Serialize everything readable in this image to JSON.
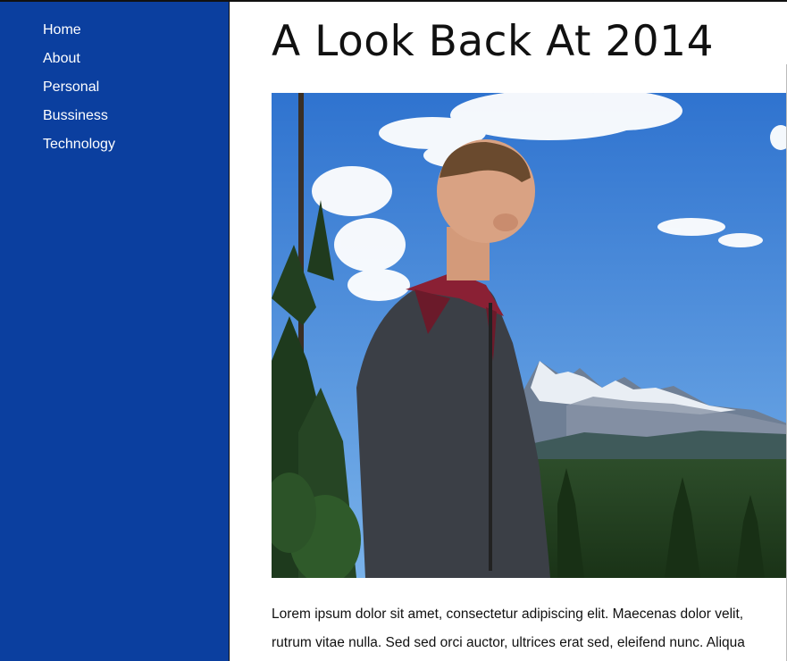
{
  "nav": {
    "items": [
      {
        "label": "Home"
      },
      {
        "label": "About"
      },
      {
        "label": "Personal"
      },
      {
        "label": "Bussiness"
      },
      {
        "label": "Technology"
      }
    ]
  },
  "article": {
    "title": "A Look Back At 2014",
    "image_alt": "Man in a grey hoodie looking over a mountain valley",
    "paragraph_lines": [
      "Lorem ipsum dolor sit amet, consectetur adipiscing elit. Maecenas dolor velit,",
      "rutrum vitae nulla. Sed sed orci auctor, ultrices erat sed, eleifend nunc. Aliqua"
    ]
  },
  "colors": {
    "sidebar": "#0b3f9f",
    "sky": "#3a7fd6",
    "forest": "#1f3d1c"
  }
}
